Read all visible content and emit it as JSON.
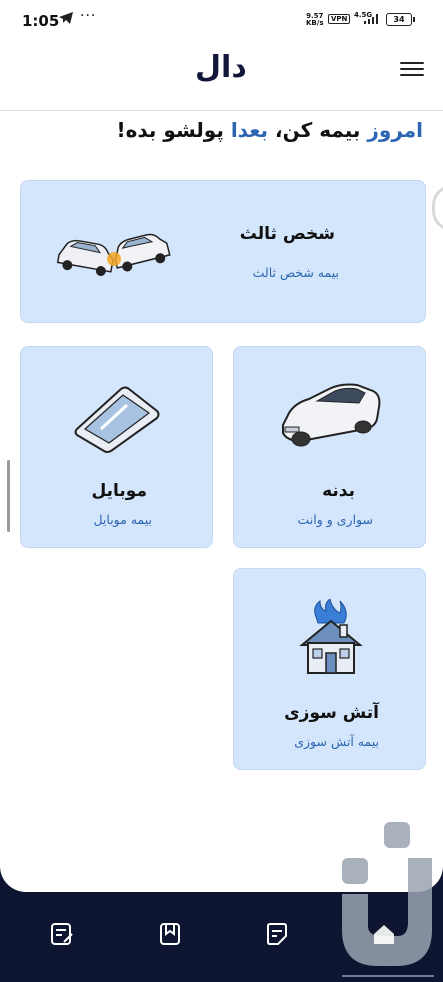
{
  "status_bar": {
    "time": "1:05",
    "speed_value": "9.57",
    "speed_unit": "KB/s",
    "vpn": "VPN",
    "network": "4.5G",
    "battery": "34"
  },
  "header": {
    "logo": "دال",
    "menu_icon": "hamburger-icon"
  },
  "tagline": {
    "part1": "امروز",
    "part2": " بیمه کن، ",
    "part3": "بعدا",
    "part4": " پولشو بده!"
  },
  "cards": {
    "third_party": {
      "title": "شخص ثالث",
      "subtitle": "بیمه شخص ثالث",
      "icon": "car-crash-icon"
    },
    "body": {
      "title": "بدنه",
      "subtitle": "سواری و وانت",
      "icon": "car-icon"
    },
    "mobile": {
      "title": "موبایل",
      "subtitle": "بیمه موبایل",
      "icon": "smartphone-icon"
    },
    "fire": {
      "title": "آتش سوزی",
      "subtitle": "بیمه آتش سوزی",
      "icon": "burning-house-icon"
    }
  },
  "bottom_nav": {
    "items": [
      "notes-icon",
      "bookmark-icon",
      "document-icon",
      "home-icon"
    ]
  },
  "colors": {
    "accent": "#2d65b3",
    "card_bg": "#d4e6fb",
    "nav_bg": "#0e1530"
  }
}
